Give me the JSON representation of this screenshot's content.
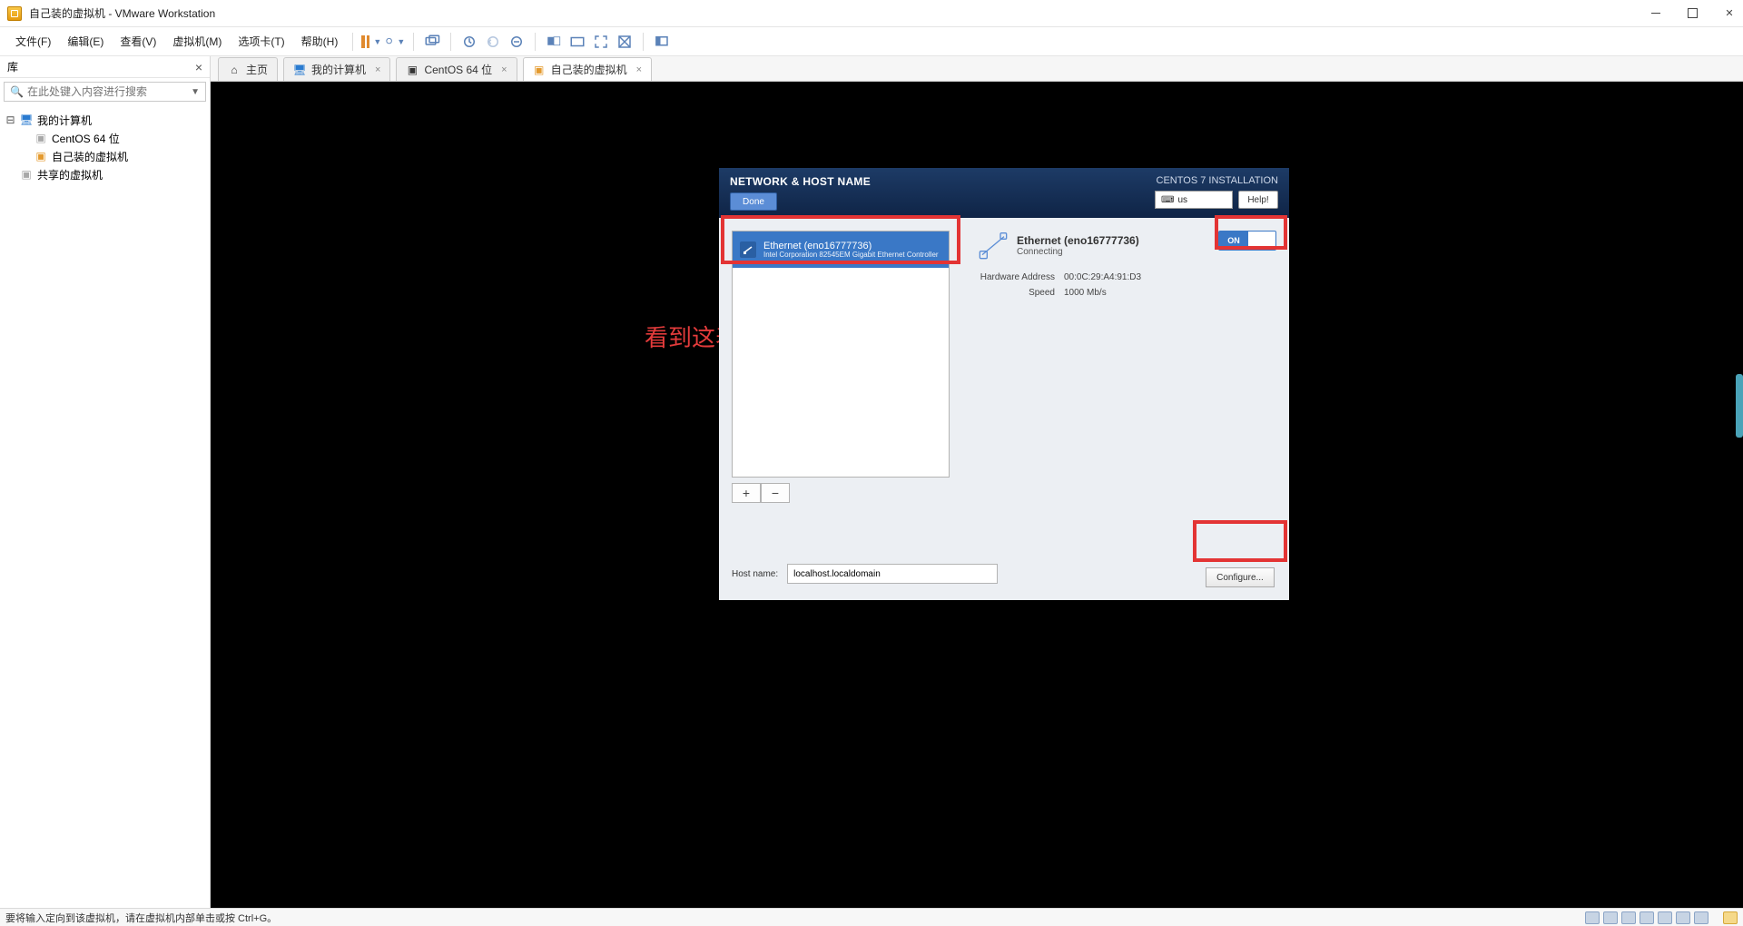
{
  "window": {
    "title": "自己装的虚拟机 - VMware Workstation"
  },
  "menu": {
    "file": "文件(F)",
    "edit": "编辑(E)",
    "view": "查看(V)",
    "vm": "虚拟机(M)",
    "tabs": "选项卡(T)",
    "help": "帮助(H)"
  },
  "library": {
    "heading": "库",
    "search_placeholder": "在此处键入内容进行搜索",
    "tree": {
      "root": "我的计算机",
      "child1": "CentOS 64 位",
      "child2": "自己装的虚拟机",
      "shared": "共享的虚拟机"
    }
  },
  "tabs": {
    "home": "主页",
    "mypc": "我的计算机",
    "centos": "CentOS 64 位",
    "self": "自己装的虚拟机"
  },
  "annotation": "看到这表示网卡配置好了",
  "installer": {
    "title": "NETWORK & HOST NAME",
    "done": "Done",
    "brand": "CENTOS 7 INSTALLATION",
    "lang": "us",
    "help": "Help!",
    "net_item_name": "Ethernet (eno16777736)",
    "net_item_desc": "Intel Corporation 82545EM Gigabit Ethernet Controller",
    "plus": "+",
    "minus": "−",
    "detail_name": "Ethernet (eno16777736)",
    "detail_status": "Connecting",
    "switch": "ON",
    "hw_label": "Hardware Address",
    "hw_value": "00:0C:29:A4:91:D3",
    "speed_label": "Speed",
    "speed_value": "1000 Mb/s",
    "configure": "Configure...",
    "hostname_label": "Host name:",
    "hostname_value": "localhost.localdomain"
  },
  "status": "要将输入定向到该虚拟机，请在虚拟机内部单击或按 Ctrl+G。"
}
